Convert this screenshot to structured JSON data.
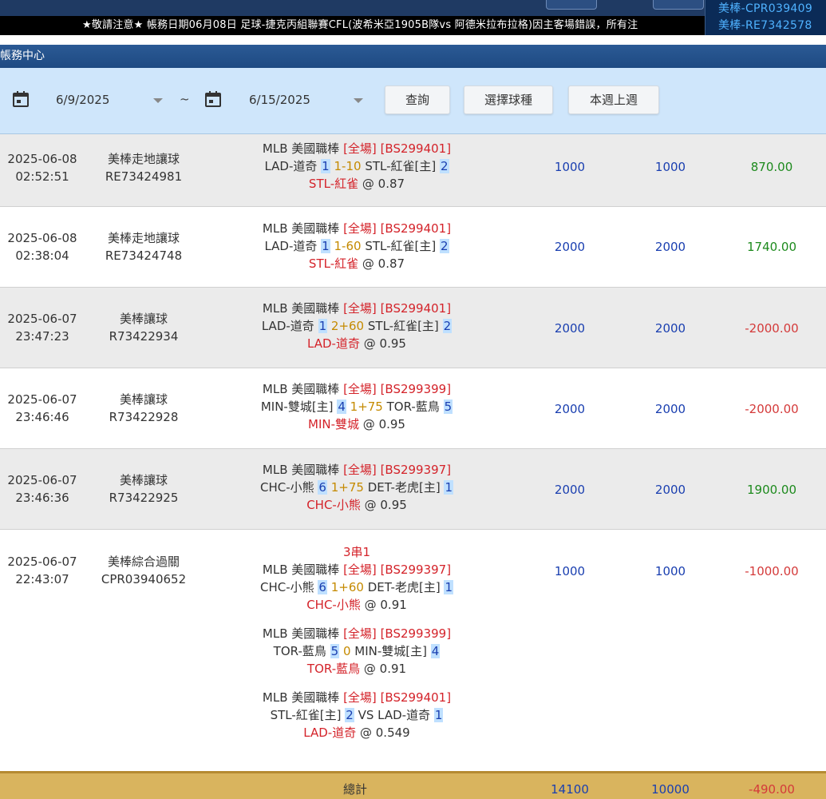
{
  "ticker": {
    "text": "★敬請注意★ 帳務日期06月08日 足球-捷克丙組聯賽CFL(波希米亞1905B隊vs 阿德米拉布拉格)因主客場錯誤，所有注"
  },
  "side_panel": {
    "lines": [
      "美棒-CPR039409",
      "美棒-RE7342578"
    ]
  },
  "title": "帳務中心",
  "filter": {
    "start_date": "6/9/2025",
    "end_date": "6/15/2025",
    "tilde": "~",
    "query_label": "查詢",
    "sport_label": "選擇球種",
    "week_label": "本週上週"
  },
  "rows": [
    {
      "date": "2025-06-08",
      "time": "02:52:51",
      "bet_type": "美棒走地讓球",
      "ticket": "RE73424981",
      "legs": [
        {
          "league": "MLB 美國職棒",
          "scope": "[全場]",
          "code": "[BS299401]",
          "home": "LAD-道奇",
          "hn": "1",
          "line": "1-10",
          "away": "STL-紅雀[主]",
          "an": "2",
          "pick": "STL-紅雀",
          "odds": "0.87"
        }
      ],
      "stake": "1000",
      "valid": "1000",
      "result": "870.00",
      "result_sign": "pos"
    },
    {
      "date": "2025-06-08",
      "time": "02:38:04",
      "bet_type": "美棒走地讓球",
      "ticket": "RE73424748",
      "legs": [
        {
          "league": "MLB 美國職棒",
          "scope": "[全場]",
          "code": "[BS299401]",
          "home": "LAD-道奇",
          "hn": "1",
          "line": "1-60",
          "away": "STL-紅雀[主]",
          "an": "2",
          "pick": "STL-紅雀",
          "odds": "0.87"
        }
      ],
      "stake": "2000",
      "valid": "2000",
      "result": "1740.00",
      "result_sign": "pos"
    },
    {
      "date": "2025-06-07",
      "time": "23:47:23",
      "bet_type": "美棒讓球",
      "ticket": "R73422934",
      "legs": [
        {
          "league": "MLB 美國職棒",
          "scope": "[全場]",
          "code": "[BS299401]",
          "home": "LAD-道奇",
          "hn": "1",
          "line": "2+60",
          "away": "STL-紅雀[主]",
          "an": "2",
          "pick": "LAD-道奇",
          "odds": "0.95"
        }
      ],
      "stake": "2000",
      "valid": "2000",
      "result": "-2000.00",
      "result_sign": "neg"
    },
    {
      "date": "2025-06-07",
      "time": "23:46:46",
      "bet_type": "美棒讓球",
      "ticket": "R73422928",
      "legs": [
        {
          "league": "MLB 美國職棒",
          "scope": "[全場]",
          "code": "[BS299399]",
          "home": "MIN-雙城[主]",
          "hn": "4",
          "line": "1+75",
          "away": "TOR-藍鳥",
          "an": "5",
          "pick": "MIN-雙城",
          "odds": "0.95"
        }
      ],
      "stake": "2000",
      "valid": "2000",
      "result": "-2000.00",
      "result_sign": "neg"
    },
    {
      "date": "2025-06-07",
      "time": "23:46:36",
      "bet_type": "美棒讓球",
      "ticket": "R73422925",
      "legs": [
        {
          "league": "MLB 美國職棒",
          "scope": "[全場]",
          "code": "[BS299397]",
          "home": "CHC-小熊",
          "hn": "6",
          "line": "1+75",
          "away": "DET-老虎[主]",
          "an": "1",
          "pick": "CHC-小熊",
          "odds": "0.95"
        }
      ],
      "stake": "2000",
      "valid": "2000",
      "result": "1900.00",
      "result_sign": "pos"
    },
    {
      "date": "2025-06-07",
      "time": "22:43:07",
      "bet_type": "美棒綜合過關",
      "ticket": "CPR03940652",
      "parlay": "3串1",
      "legs": [
        {
          "league": "MLB 美國職棒",
          "scope": "[全場]",
          "code": "[BS299397]",
          "home": "CHC-小熊",
          "hn": "6",
          "line": "1+60",
          "away": "DET-老虎[主]",
          "an": "1",
          "pick": "CHC-小熊",
          "odds": "0.91"
        },
        {
          "league": "MLB 美國職棒",
          "scope": "[全場]",
          "code": "[BS299399]",
          "home": "TOR-藍鳥",
          "hn": "5",
          "line": "0",
          "away": "MIN-雙城[主]",
          "an": "4",
          "pick": "TOR-藍鳥",
          "odds": "0.91"
        },
        {
          "league": "MLB 美國職棒",
          "scope": "[全場]",
          "code": "[BS299401]",
          "home": "STL-紅雀[主]",
          "hn": "2",
          "vs": "VS",
          "away": "LAD-道奇",
          "an": "1",
          "pick": "LAD-道奇",
          "odds": "0.549"
        }
      ],
      "stake": "1000",
      "valid": "1000",
      "result": "-1000.00",
      "result_sign": "neg"
    }
  ],
  "total": {
    "label": "總計",
    "stake": "14100",
    "valid": "10000",
    "result": "-490.00"
  },
  "colors": {
    "header": "#1f3a63",
    "title_bar": "#2b5a95",
    "filter_bg": "#cfe6fb",
    "total_bg": "#d9b45e",
    "amount_blue": "#1a3fb0",
    "win_green": "#1d8a1d",
    "loss_red": "#d43a3a"
  }
}
